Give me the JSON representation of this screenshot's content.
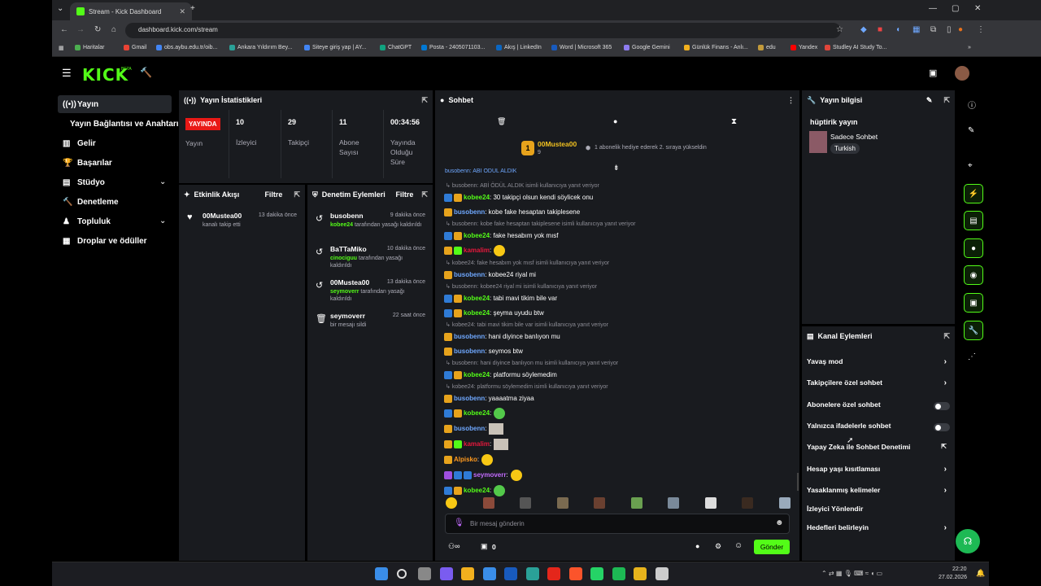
{
  "browser": {
    "tab_title": "Stream - Kick Dashboard",
    "url": "dashboard.kick.com/stream",
    "bookmarks": [
      "Haritalar",
      "Gmail",
      "obs.aybu.edu.tr/oib...",
      "Ankara Yıldırım Bey...",
      "Siteye giriş yap | AY...",
      "ChatGPT",
      "Posta - 2405071103...",
      "Akış | LinkedIn",
      "Word | Microsoft 365",
      "Google Gemini",
      "Günlük Finans - Anlı...",
      "edu",
      "Yandex",
      "Studley AI Study To..."
    ],
    "bookmark_colors": [
      "#4caf50",
      "#ea4335",
      "#4285f4",
      "#2aa198",
      "#4285f4",
      "#10a37f",
      "#0078d4",
      "#0a66c2",
      "#185abd",
      "#8e7cf0",
      "#f2b01e",
      "#c29a3a",
      "#ff0000",
      "#e0453a"
    ]
  },
  "brand": {
    "logo": "KICK",
    "beta": "BETA",
    "accent": "#53fc18"
  },
  "sidebar": {
    "items": [
      {
        "label": "Yayın",
        "icon": "broadcast-icon"
      },
      {
        "label": "Yayın Bağlantısı ve Anahtarı",
        "icon": ""
      },
      {
        "label": "Gelir",
        "icon": "chart-icon"
      },
      {
        "label": "Başarılar",
        "icon": "trophy-icon"
      },
      {
        "label": "Stüdyo",
        "icon": "studio-icon"
      },
      {
        "label": "Denetleme",
        "icon": "hammer-icon"
      },
      {
        "label": "Topluluk",
        "icon": "community-icon"
      },
      {
        "label": "Droplar ve ödüller",
        "icon": "gift-icon"
      }
    ]
  },
  "stats": {
    "title": "Yayın İstatistikleri",
    "live": "YAYINDA",
    "live_label": "Yayın",
    "viewers": "10",
    "viewers_label": "İzleyici",
    "followers": "29",
    "followers_label": "Takipçi",
    "subs": "11",
    "subs_label": "Abone Sayısı",
    "uptime": "00:34:56",
    "uptime_label": "Yayında Olduğu Süre"
  },
  "activity": {
    "title": "Etkinlik Akışı",
    "filter": "Filtre",
    "items": [
      {
        "user": "00Mustea00",
        "time": "13 dakika önce",
        "desc": "kanalı takip etti"
      }
    ]
  },
  "modactions": {
    "title": "Denetim Eylemleri",
    "filter": "Filtre",
    "items": [
      {
        "user": "busobenn",
        "time": "9 dakika önce",
        "actor": "kobee24",
        "desc": "tarafından yasağı kaldırıldı"
      },
      {
        "user": "BaTTaMiko",
        "time": "10 dakika önce",
        "actor": "cinociguu",
        "desc": "tarafından yasağı kaldırıldı"
      },
      {
        "user": "00Mustea00",
        "time": "13 dakika önce",
        "actor": "seymoverr",
        "desc": "tarafından yasağı kaldırıldı"
      },
      {
        "user": "seymoverr",
        "time": "22 saat önce",
        "actor": "",
        "desc": "bir mesajı sildi"
      }
    ]
  },
  "chat": {
    "title": "Sohbet",
    "pinned_user": "00Mustea00",
    "pinned_count": "9",
    "pinned_text": "1 abonelik hediye ederek 2. sıraya yükseldin",
    "top_cut": "busobenn: ABİ ÖDÜL ALDIK",
    "placeholder": "Bir mesaj gönderin",
    "points": "0",
    "send": "Gönder",
    "lines": [
      {
        "type": "reply",
        "text": "busobenn: ABİ ÖDÜL ALDIK isimli kullanıcıya yanıt veriyor"
      },
      {
        "type": "msg",
        "badges": [
          "b-blue",
          "b-gold"
        ],
        "user": "kobee24",
        "color": "#53fc18",
        "text": ": 30 takipçi olsun kendi söylicek onu"
      },
      {
        "type": "msg",
        "badges": [
          "b-gold"
        ],
        "user": "busobenn",
        "color": "#6fa8ff",
        "text": ": kobe fake hesaptan takiplesene"
      },
      {
        "type": "reply",
        "text": "busobenn: kobe fake hesaptan takiplesene isimli kullanıcıya yanıt veriyor"
      },
      {
        "type": "msg",
        "badges": [
          "b-blue",
          "b-gold"
        ],
        "user": "kobee24",
        "color": "#53fc18",
        "text": ": fake hesabım yok mısf"
      },
      {
        "type": "msg",
        "badges": [
          "b-gold",
          "b-green"
        ],
        "user": "kamalim",
        "color": "#e6183c",
        "text": ":",
        "emote": "emo-y"
      },
      {
        "type": "reply",
        "text": "kobee24: fake hesabım yok mısf isimli kullanıcıya yanıt veriyor"
      },
      {
        "type": "msg",
        "badges": [
          "b-gold"
        ],
        "user": "busobenn",
        "color": "#6fa8ff",
        "text": ": kobee24 riyal mi"
      },
      {
        "type": "reply",
        "text": "busobenn: kobee24 riyal mi isimli kullanıcıya yanıt veriyor"
      },
      {
        "type": "msg",
        "badges": [
          "b-blue",
          "b-gold"
        ],
        "user": "kobee24",
        "color": "#53fc18",
        "text": ": tabi mavi tikim bile var"
      },
      {
        "type": "msg",
        "badges": [
          "b-blue",
          "b-gold"
        ],
        "user": "kobee24",
        "color": "#53fc18",
        "text": ": şeyma uyudu btw"
      },
      {
        "type": "reply",
        "text": "kobee24: tabi mavi tikim bile var isimli kullanıcıya yanıt veriyor"
      },
      {
        "type": "msg",
        "badges": [
          "b-gold"
        ],
        "user": "busobenn",
        "color": "#6fa8ff",
        "text": ": hani diyince banlıyon mu"
      },
      {
        "type": "msg",
        "badges": [
          "b-gold"
        ],
        "user": "busobenn",
        "color": "#6fa8ff",
        "text": ": seymos btw"
      },
      {
        "type": "reply",
        "text": "busobenn: hani diyince banlıyon mu isimli kullanıcıya yanıt veriyor"
      },
      {
        "type": "msg",
        "badges": [
          "b-blue",
          "b-gold"
        ],
        "user": "kobee24",
        "color": "#53fc18",
        "text": ": platformu söylemedim"
      },
      {
        "type": "reply",
        "text": "kobee24: platformu söylemedim isimli kullanıcıya yanıt veriyor"
      },
      {
        "type": "msg",
        "badges": [
          "b-gold"
        ],
        "user": "busobenn",
        "color": "#6fa8ff",
        "text": ": yaaaatma ziyaa"
      },
      {
        "type": "msg",
        "badges": [
          "b-blue",
          "b-gold"
        ],
        "user": "kobee24",
        "color": "#53fc18",
        "text": ":",
        "emote": "emo-g"
      },
      {
        "type": "msg",
        "badges": [
          "b-gold"
        ],
        "user": "busobenn",
        "color": "#6fa8ff",
        "text": ":",
        "emote": "emo-img"
      },
      {
        "type": "msg",
        "badges": [
          "b-gold",
          "b-green"
        ],
        "user": "kamalim",
        "color": "#e6183c",
        "text": ":",
        "emote": "emo-img"
      },
      {
        "type": "msg",
        "badges": [
          "b-gold"
        ],
        "user": "Alpisko",
        "color": "#ff9a1f",
        "text": ":",
        "emote": "emo-y"
      },
      {
        "type": "msg",
        "badges": [
          "b-purple",
          "b-blue",
          "b-blue"
        ],
        "user": "seymoverr",
        "color": "#c36bff",
        "text": ":",
        "emote": "emo-y"
      },
      {
        "type": "msg",
        "badges": [
          "b-blue",
          "b-gold"
        ],
        "user": "kobee24",
        "color": "#53fc18",
        "text": ":",
        "emote": "emo-g"
      }
    ]
  },
  "streaminfo": {
    "title": "Yayın bilgisi",
    "stream_title": "hüptirik yayın",
    "category": "Sadece Sohbet",
    "language": "Turkish"
  },
  "channel_actions": {
    "title": "Kanal Eylemleri",
    "items": [
      {
        "label": "Yavaş mod",
        "kind": "arrow"
      },
      {
        "label": "Takipçilere özel sohbet",
        "kind": "arrow"
      },
      {
        "label": "Abonelere özel sohbet",
        "kind": "toggle"
      },
      {
        "label": "Yalnızca ifadelerle sohbet",
        "kind": "toggle"
      },
      {
        "label": "Yapay Zeka ile Sohbet Denetimi",
        "kind": "external"
      },
      {
        "label": "Hesap yaşı kısıtlaması",
        "kind": "arrow"
      },
      {
        "label": "Yasaklanmış kelimeler",
        "kind": "arrow"
      },
      {
        "label": "İzleyici Yönlendir",
        "kind": "none"
      },
      {
        "label": "Hedefleri belirleyin",
        "kind": "arrow"
      }
    ]
  },
  "taskbar": {
    "time": "22:20",
    "date": "27.02.2026"
  }
}
